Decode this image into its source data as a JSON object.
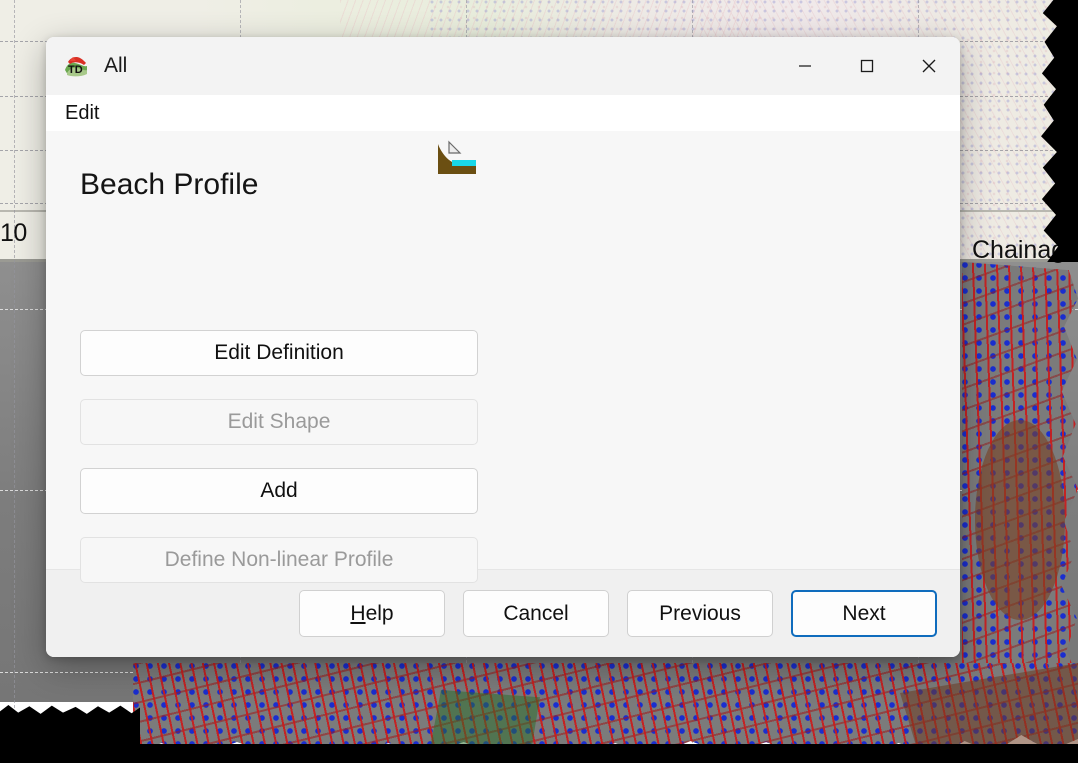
{
  "window": {
    "title": "All",
    "app_icon": "td-app-icon",
    "controls": {
      "minimize": "minimize-icon",
      "maximize": "maximize-icon",
      "close": "close-icon"
    }
  },
  "menubar": {
    "items": [
      {
        "label": "Edit",
        "name": "menu-edit"
      }
    ]
  },
  "page": {
    "title": "Beach Profile",
    "icon": "beach-profile-icon",
    "buttons": [
      {
        "label": "Edit Definition",
        "name": "edit-definition-button",
        "disabled": false
      },
      {
        "label": "Edit Shape",
        "name": "edit-shape-button",
        "disabled": true
      },
      {
        "label": "Add",
        "name": "add-button",
        "disabled": false
      },
      {
        "label": "Define Non-linear Profile",
        "name": "define-nonlinear-profile-button",
        "disabled": true
      }
    ]
  },
  "footer": {
    "help": {
      "accel": "H",
      "rest": "elp"
    },
    "buttons": [
      {
        "label": "Cancel",
        "name": "cancel-button",
        "primary": false
      },
      {
        "label": "Previous",
        "name": "previous-button",
        "primary": false
      },
      {
        "label": "Next",
        "name": "next-button",
        "primary": true
      }
    ]
  },
  "backdrop": {
    "y_axis_label": "10",
    "x_axis_label": "Chainag"
  },
  "colors": {
    "accent": "#0f6cbd",
    "titlebar": "#f3f3f3",
    "body": "#f7f7f7",
    "footer": "#f0f0f0",
    "disabled_text": "#9a9a9a",
    "contour_line": "#c81e1e",
    "contour_point": "#1a2ecf"
  }
}
